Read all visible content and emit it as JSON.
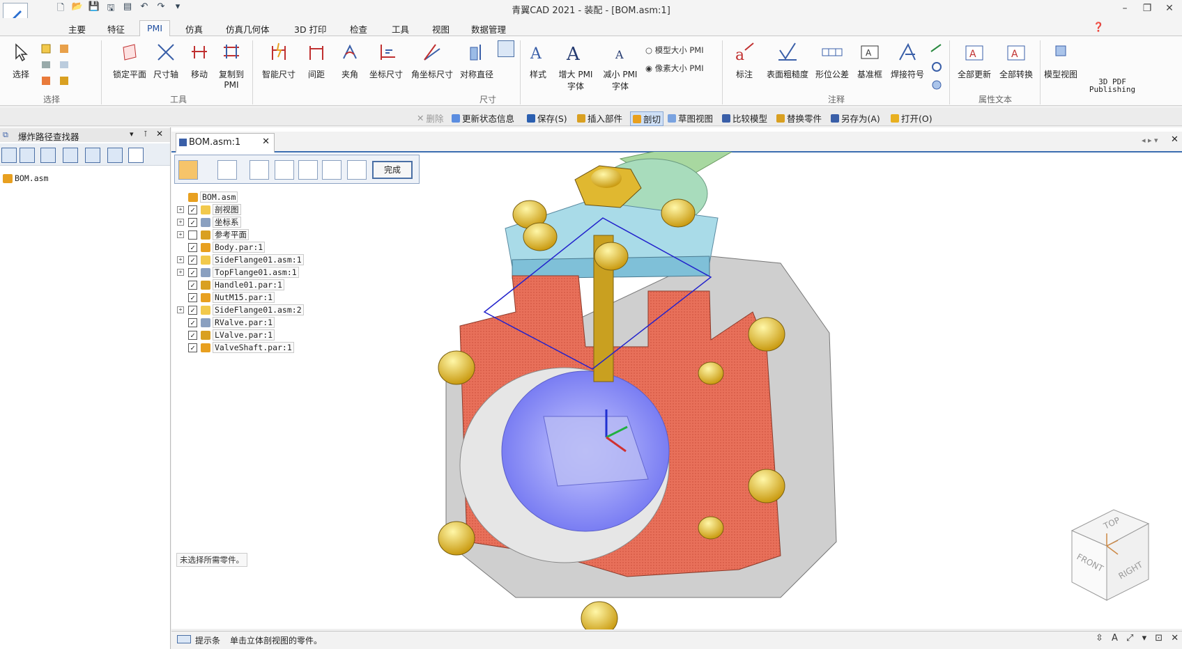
{
  "window": {
    "title": "青翼CAD 2021 - 装配 - [BOM.asm:1]",
    "controls": [
      "–",
      "❐",
      "✕"
    ]
  },
  "ribbon_tabs": [
    "主要",
    "特征",
    "PMI",
    "仿真",
    "仿真几何体",
    "3D 打印",
    "检查",
    "工具",
    "视图",
    "数据管理"
  ],
  "ribbon": {
    "select": {
      "label": "选择",
      "group": "选择"
    },
    "tools": {
      "items": [
        "锁定平面",
        "尺寸轴",
        "移动",
        "复制到PMI"
      ],
      "group": "工具"
    },
    "dims": {
      "items": [
        "智能尺寸",
        "间距",
        "夹角",
        "坐标尺寸",
        "角坐标尺寸",
        "对称直径"
      ],
      "group": "尺寸"
    },
    "style": {
      "items": [
        "样式",
        "增大 PMI 字体",
        "减小 PMI 字体"
      ]
    },
    "size_options": [
      "模型大小 PMI",
      "像素大小 PMI"
    ],
    "annotate": {
      "items": [
        "标注",
        "表面粗糙度",
        "形位公差",
        "基准框",
        "焊接符号"
      ],
      "group": "注释"
    },
    "attr": {
      "items": [
        "全部更新",
        "全部转换"
      ],
      "group": "属性文本"
    },
    "model_view": "模型视图",
    "publish": "3D PDF Publishing"
  },
  "commandbar": [
    "删除",
    "更新状态信息",
    "保存(S)",
    "插入部件",
    "剖切",
    "草图视图",
    "比较模型",
    "替换零件",
    "另存为(A)",
    "打开(O)"
  ],
  "left_pane": {
    "title": "爆炸路径查找器",
    "root": "BOM.asm"
  },
  "document": {
    "tab": "BOM.asm:1",
    "done_button": "完成",
    "tree": [
      {
        "label": "BOM.asm",
        "level": 0,
        "exp": false,
        "cb": null
      },
      {
        "label": "剖视图",
        "level": 1,
        "exp": true,
        "cb": true
      },
      {
        "label": "坐标系",
        "level": 1,
        "exp": true,
        "cb": true
      },
      {
        "label": "参考平面",
        "level": 1,
        "exp": true,
        "cb": false
      },
      {
        "label": "Body.par:1",
        "level": 1,
        "exp": false,
        "cb": true
      },
      {
        "label": "SideFlange01.asm:1",
        "level": 1,
        "exp": true,
        "cb": true
      },
      {
        "label": "TopFlange01.asm:1",
        "level": 1,
        "exp": true,
        "cb": true
      },
      {
        "label": "Handle01.par:1",
        "level": 1,
        "exp": false,
        "cb": true
      },
      {
        "label": "NutM15.par:1",
        "level": 1,
        "exp": false,
        "cb": true
      },
      {
        "label": "SideFlange01.asm:2",
        "level": 1,
        "exp": true,
        "cb": true
      },
      {
        "label": "RValve.par:1",
        "level": 1,
        "exp": false,
        "cb": true
      },
      {
        "label": "LValve.par:1",
        "level": 1,
        "exp": false,
        "cb": true
      },
      {
        "label": "ValveShaft.par:1",
        "level": 1,
        "exp": false,
        "cb": true
      }
    ],
    "hint": "未选择所需零件。"
  },
  "status": {
    "prompt_label": "提示条",
    "message": "单击立体剖视图的零件。"
  },
  "viewcube": {
    "top": "TOP",
    "front": "FRONT",
    "right": "RIGHT"
  },
  "colors": {
    "accent": "#3b6db0",
    "cut_face": "#e8705a",
    "bolt": "#d9b520",
    "flange": "#8fd3e8"
  }
}
